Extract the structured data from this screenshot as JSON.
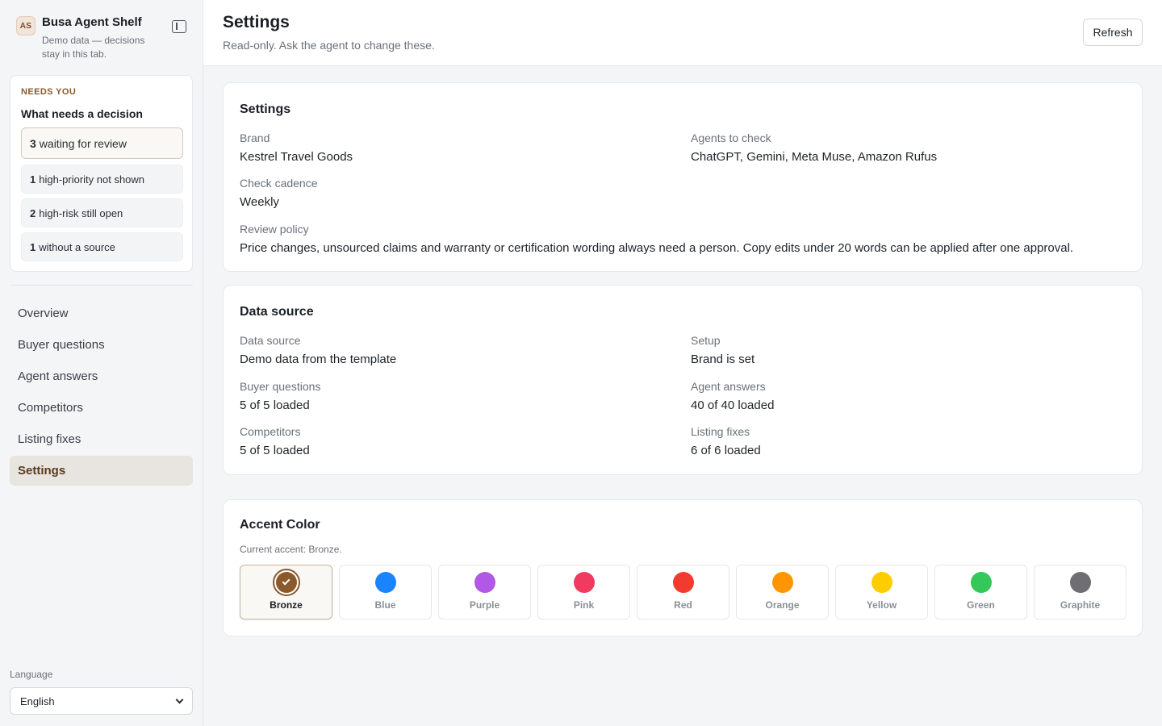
{
  "sidebar": {
    "avatar_initials": "AS",
    "brand_name": "Busa Agent Shelf",
    "brand_subtitle": "Demo data — decisions stay in this tab.",
    "collapse_icon": "sidebar-panel-icon",
    "needs": {
      "eyebrow": "NEEDS YOU",
      "title": "What needs a decision",
      "items": [
        {
          "count": "3",
          "text": "waiting for review"
        },
        {
          "count": "1",
          "text": "high-priority not shown"
        },
        {
          "count": "2",
          "text": "high-risk still open"
        },
        {
          "count": "1",
          "text": "without a source"
        }
      ]
    },
    "nav": [
      {
        "label": "Overview"
      },
      {
        "label": "Buyer questions"
      },
      {
        "label": "Agent answers"
      },
      {
        "label": "Competitors"
      },
      {
        "label": "Listing fixes"
      },
      {
        "label": "Settings",
        "active": true
      }
    ],
    "language_label": "Language",
    "language_value": "English"
  },
  "header": {
    "title": "Settings",
    "subtitle": "Read-only. Ask the agent to change these.",
    "refresh_label": "Refresh"
  },
  "settings_card": {
    "title": "Settings",
    "brand_label": "Brand",
    "brand_value": "Kestrel Travel Goods",
    "agents_label": "Agents to check",
    "agents_value": "ChatGPT, Gemini, Meta Muse, Amazon Rufus",
    "cadence_label": "Check cadence",
    "cadence_value": "Weekly",
    "policy_label": "Review policy",
    "policy_value": "Price changes, unsourced claims and warranty or certification wording always need a person. Copy edits under 20 words can be applied after one approval."
  },
  "data_card": {
    "title": "Data source",
    "source_label": "Data source",
    "source_value": "Demo data from the template",
    "setup_label": "Setup",
    "setup_value": "Brand is set",
    "questions_label": "Buyer questions",
    "questions_value": "5 of 5 loaded",
    "answers_label": "Agent answers",
    "answers_value": "40 of 40 loaded",
    "competitors_label": "Competitors",
    "competitors_value": "5 of 5 loaded",
    "fixes_label": "Listing fixes",
    "fixes_value": "6 of 6 loaded"
  },
  "accent_card": {
    "title": "Accent Color",
    "current": "Current accent: Bronze.",
    "selected": "Bronze",
    "options": [
      {
        "name": "Bronze",
        "color": "#8a5a2b"
      },
      {
        "name": "Blue",
        "color": "#1a84ff"
      },
      {
        "name": "Purple",
        "color": "#b158e6"
      },
      {
        "name": "Pink",
        "color": "#f03a5f"
      },
      {
        "name": "Red",
        "color": "#f23b2e"
      },
      {
        "name": "Orange",
        "color": "#ff9500"
      },
      {
        "name": "Yellow",
        "color": "#ffcc00"
      },
      {
        "name": "Green",
        "color": "#34c759"
      },
      {
        "name": "Graphite",
        "color": "#6e6e73"
      }
    ]
  }
}
